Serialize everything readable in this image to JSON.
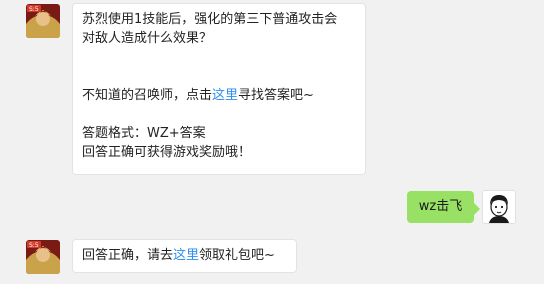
{
  "messages": [
    {
      "side": "left",
      "avatar_icon": "game-hero-avatar-icon",
      "avatar_badge": "S:5",
      "line1": "苏烈使用1技能后，强化的第三下普通攻击会",
      "line2": "对敌人造成什么效果？",
      "hint_before": "不知道的召唤师，点击",
      "hint_link": "这里",
      "hint_after": "寻找答案吧~",
      "format_line": "答题格式：WZ+答案",
      "reward_line": "回答正确可获得游戏奖励哦！"
    },
    {
      "side": "right",
      "avatar_icon": "user-cartoon-avatar-icon",
      "text": "wz击飞"
    },
    {
      "side": "left",
      "avatar_icon": "game-hero-avatar-icon",
      "avatar_badge": "S:5",
      "text_before": "回答正确，请去",
      "link": "这里",
      "text_after": "领取礼包吧~"
    }
  ],
  "colors": {
    "background": "#f1f1f1",
    "left_bubble": "#ffffff",
    "right_bubble": "#98e165",
    "link": "#2e8ef0"
  }
}
